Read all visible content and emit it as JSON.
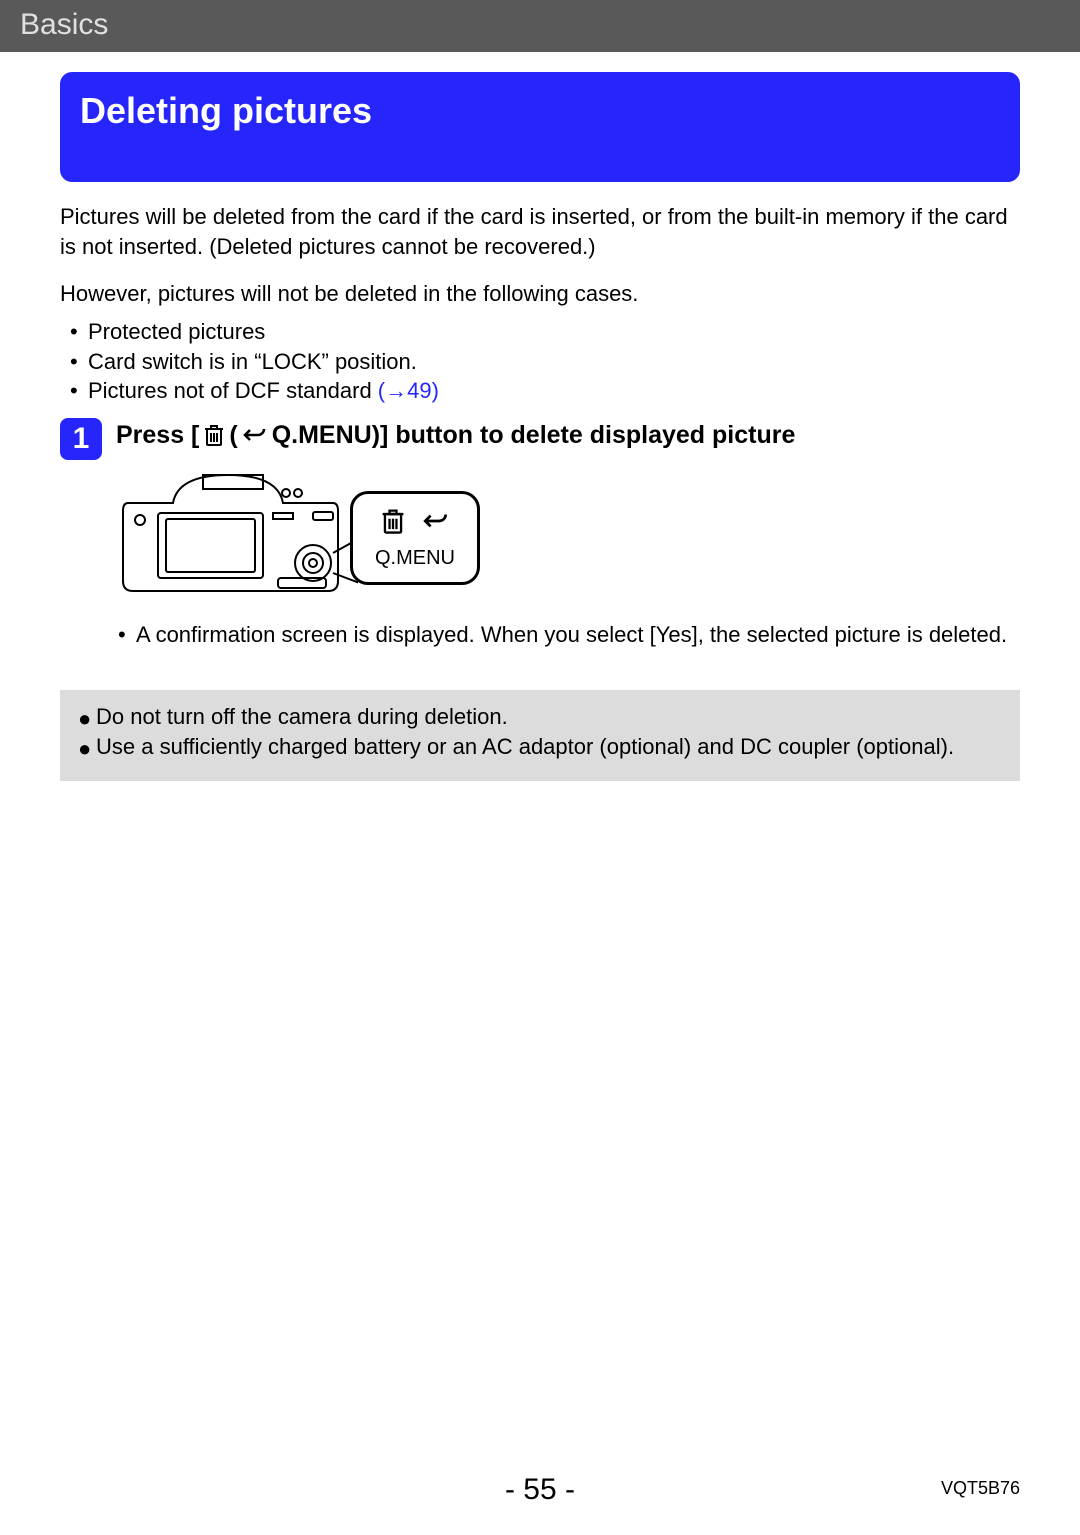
{
  "section": "Basics",
  "title": "Deleting pictures",
  "intro_p1": "Pictures will be deleted from the card if the card is inserted, or from the built-in memory if the card is not inserted. (Deleted pictures cannot be recovered.)",
  "intro_p2": "However, pictures will not be deleted in the following cases.",
  "exceptions": {
    "b1": "Protected pictures",
    "b2": "Card switch is in “LOCK” position.",
    "b3_prefix": "Pictures not of DCF standard ",
    "b3_link": "(→49)"
  },
  "step1": {
    "number": "1",
    "title_prefix": "Press [",
    "title_mid": " (",
    "title_suffix": " Q.MENU)] button to delete displayed picture",
    "callout_label": "Q.MENU",
    "confirm_text": "A confirmation screen is displayed. When you select [Yes], the selected picture is deleted."
  },
  "notes": {
    "n1": "Do not turn off the camera during deletion.",
    "n2": "Use a sufficiently charged battery or an AC adaptor (optional) and DC coupler (optional)."
  },
  "footer": {
    "page": "- 55 -",
    "doc_id": "VQT5B76"
  }
}
